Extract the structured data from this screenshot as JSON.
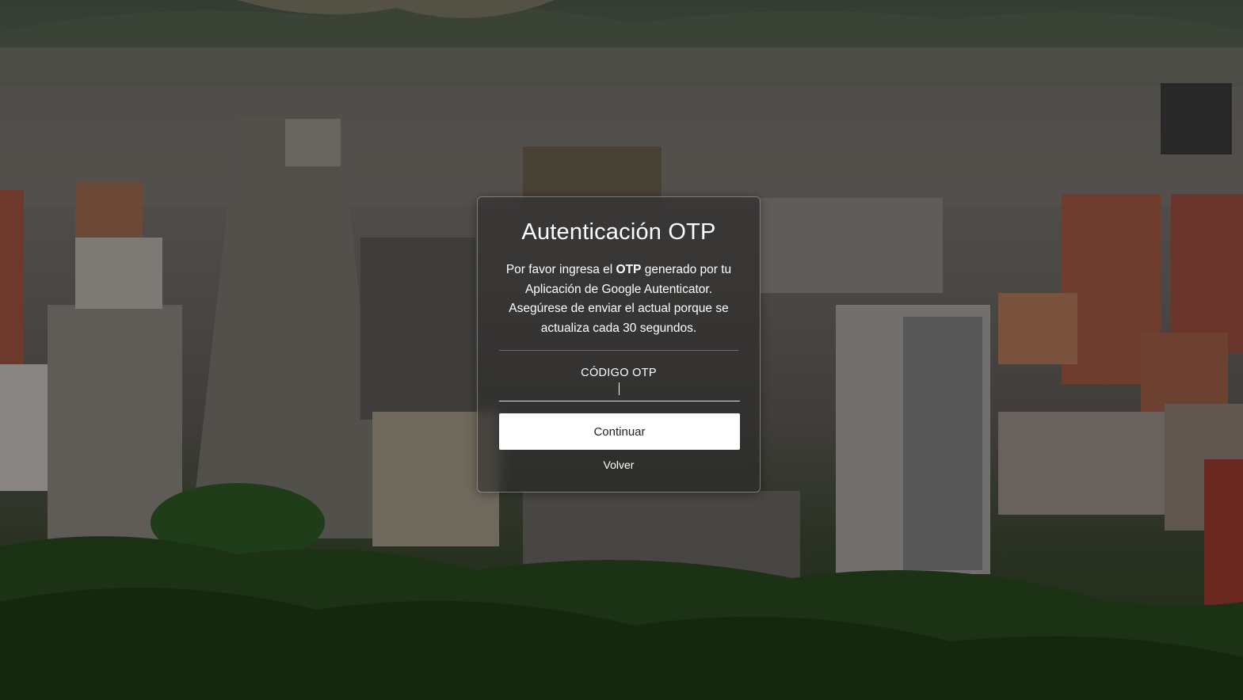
{
  "card": {
    "title": "Autenticación OTP",
    "desc_pre": "Por favor ingresa el ",
    "desc_bold": "OTP",
    "desc_post": " generado por tu Aplicación de Google Autenticator. Asegúrese de enviar el actual porque se actualiza cada 30 segundos.",
    "otp_label": "CÓDIGO OTP",
    "otp_value": "",
    "continue_label": "Continuar",
    "back_label": "Volver"
  },
  "colors": {
    "button_bg": "#ffffff",
    "text": "#ffffff",
    "card_bg": "rgba(40,40,40,0.55)"
  }
}
